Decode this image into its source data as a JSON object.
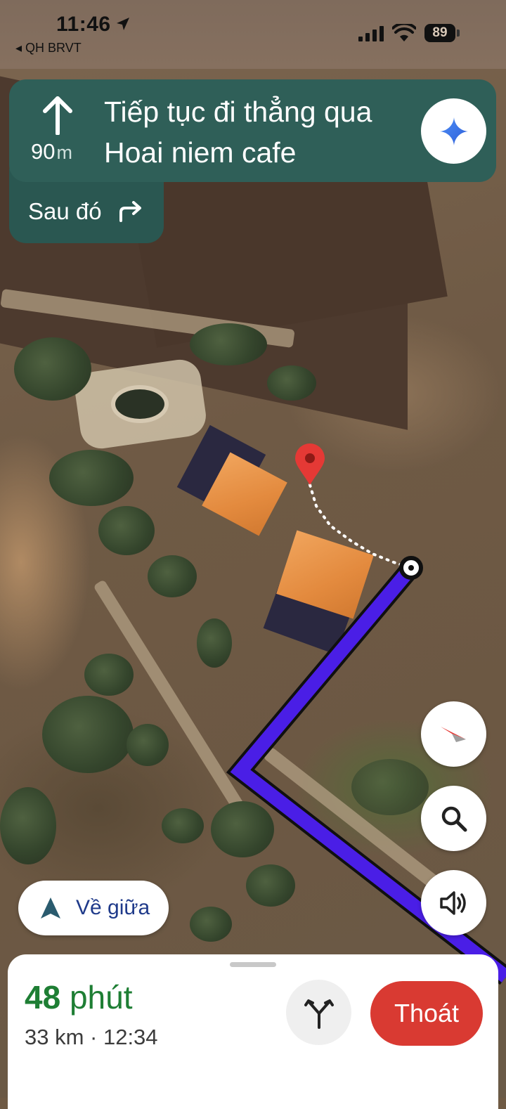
{
  "status_bar": {
    "time": "11:46",
    "back_app": "◂ QH BRVT",
    "battery": "89"
  },
  "navigation": {
    "distance_value": "90",
    "distance_unit": "m",
    "instruction": "Tiếp tục đi thẳng qua Hoai niem cafe",
    "then_label": "Sau đó",
    "then_icon": "turn-right-icon",
    "maneuver_icon": "straight-arrow-icon"
  },
  "map_controls": {
    "compass_icon": "compass-icon",
    "search_icon": "search-icon",
    "sound_icon": "volume-icon",
    "recenter_label": "Về giữa"
  },
  "trip": {
    "eta_number": "48",
    "eta_unit": "phút",
    "summary": "33 km · 12:34",
    "exit_label": "Thoát",
    "alternate_routes_icon": "alternate-routes-icon"
  },
  "colors": {
    "nav_header": "#2f5f58",
    "route": "#4a1ee6",
    "eta_green": "#1e7e34",
    "exit_red": "#d93a32",
    "destination_pin": "#e53935"
  }
}
